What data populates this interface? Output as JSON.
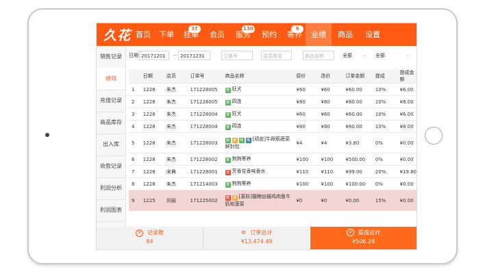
{
  "brand": {
    "logo": "久花"
  },
  "nav": [
    {
      "label": "首页"
    },
    {
      "label": "下单"
    },
    {
      "label": "挂单",
      "badge": "37"
    },
    {
      "label": "会员"
    },
    {
      "label": "服务",
      "badge": "130"
    },
    {
      "label": "预约"
    },
    {
      "label": "寄养",
      "badge": "9"
    },
    {
      "label": "业绩",
      "active": true
    },
    {
      "label": "商品"
    },
    {
      "label": "设置"
    }
  ],
  "sidebar": [
    {
      "label": "销售记录"
    },
    {
      "label": "绩效",
      "active": true
    },
    {
      "label": "充值记录"
    },
    {
      "label": "商品库存"
    },
    {
      "label": "出入库"
    },
    {
      "label": "收款记录"
    },
    {
      "label": "利润分析"
    },
    {
      "label": "利润图表"
    }
  ],
  "filter": {
    "date_label": "日期",
    "date_from": "20171201",
    "date_sep": "—",
    "date_to": "20171231",
    "order_placeholder": "订单号",
    "shop_placeholder": "店员姓名",
    "product_placeholder": "商品名称",
    "select1": "全部",
    "select2": "全部"
  },
  "table": {
    "headers": [
      "日期",
      "店员",
      "订单号",
      "商品名称",
      "原价",
      "改价",
      "订单金额",
      "提成",
      "提成金额"
    ],
    "rows": [
      {
        "n": "1",
        "date": "1228",
        "staff": "朱杰",
        "order": "171228005",
        "tags": [
          {
            "t": "宠",
            "c": "#5cb85c"
          }
        ],
        "name": "狂犬",
        "orig": "¥60",
        "changed": "¥60",
        "amount": "¥60.00",
        "rate": "10%",
        "comm": "¥6.00"
      },
      {
        "n": "2",
        "date": "1228",
        "staff": "朱杰",
        "order": "171228005",
        "tags": [
          {
            "t": "宠",
            "c": "#5cb85c"
          }
        ],
        "name": "四连",
        "orig": "¥80",
        "changed": "¥80",
        "amount": "¥80.00",
        "rate": "10%",
        "comm": "¥8.00"
      },
      {
        "n": "3",
        "date": "1228",
        "staff": "朱杰",
        "order": "171228004",
        "tags": [
          {
            "t": "宠",
            "c": "#5cb85c"
          }
        ],
        "name": "狂犬",
        "orig": "¥60",
        "changed": "¥60",
        "amount": "¥60.00",
        "rate": "10%",
        "comm": "¥6.00"
      },
      {
        "n": "4",
        "date": "1228",
        "staff": "朱杰",
        "order": "171228004",
        "tags": [
          {
            "t": "宠",
            "c": "#5cb85c"
          }
        ],
        "name": "四连",
        "orig": "¥80",
        "changed": "¥80",
        "amount": "¥80.00",
        "rate": "10%",
        "comm": "¥8.00"
      },
      {
        "n": "5",
        "date": "1228",
        "staff": "朱杰",
        "order": "171228003",
        "tags": [
          {
            "t": "狗",
            "c": "#5cb85c"
          },
          {
            "t": "食",
            "c": "#f0ad4e"
          },
          {
            "t": "特",
            "c": "#5cb85c"
          },
          {
            "t": "猫",
            "c": "#337ab7"
          }
        ],
        "name": "[顽皮]牛蹄筋蔬菜鲜封包",
        "orig": "¥4",
        "changed": "¥4",
        "amount": "¥3.80",
        "rate": "0%",
        "comm": "¥0.00",
        "tall": true
      },
      {
        "n": "6",
        "date": "1228",
        "staff": "朱杰",
        "order": "171228002",
        "tags": [
          {
            "t": "宠",
            "c": "#5cb85c"
          }
        ],
        "name": "狗狗寄养",
        "orig": "¥100",
        "changed": "¥100",
        "amount": "¥500.00",
        "rate": "0%",
        "comm": "¥0.00"
      },
      {
        "n": "7",
        "date": "1228",
        "staff": "宋典",
        "order": "171228001",
        "tags": [
          {
            "t": "宠",
            "c": "#e74c3c"
          }
        ],
        "name": "芳香花香味香水",
        "orig": "¥110",
        "changed": "¥110",
        "amount": "¥99.00",
        "rate": "20%",
        "comm": "¥19.80"
      },
      {
        "n": "8",
        "date": "1228",
        "staff": "朱杰",
        "order": "171214003",
        "tags": [
          {
            "t": "宠",
            "c": "#5cb85c"
          }
        ],
        "name": "狗狗寄养",
        "orig": "¥100",
        "changed": "¥100",
        "amount": "¥100.00",
        "rate": "0%",
        "comm": "¥0.00"
      },
      {
        "n": "9",
        "date": "1225",
        "staff": "刘丽",
        "order": "171225002",
        "tags": [
          {
            "t": "赠",
            "c": "#e74c3c"
          },
          {
            "t": "食",
            "c": "#f0ad4e"
          }
        ],
        "name": "[喜跃]猫粮幼猫鸡肉鱼牛奶和菠菜",
        "orig": "¥0",
        "changed": "¥0",
        "amount": "¥0.00",
        "rate": "15%",
        "comm": "¥0.00",
        "tall": true,
        "highlight": true
      }
    ]
  },
  "footer": {
    "records_label": "记录数",
    "records_value": "84",
    "orders_label": "订单总计",
    "orders_value": "¥13,474.49",
    "commission_label": "提成总计",
    "commission_value": "¥506.28"
  },
  "colors": {
    "accent": "#ff5a12",
    "highlight_row": "#f3d5d4"
  }
}
